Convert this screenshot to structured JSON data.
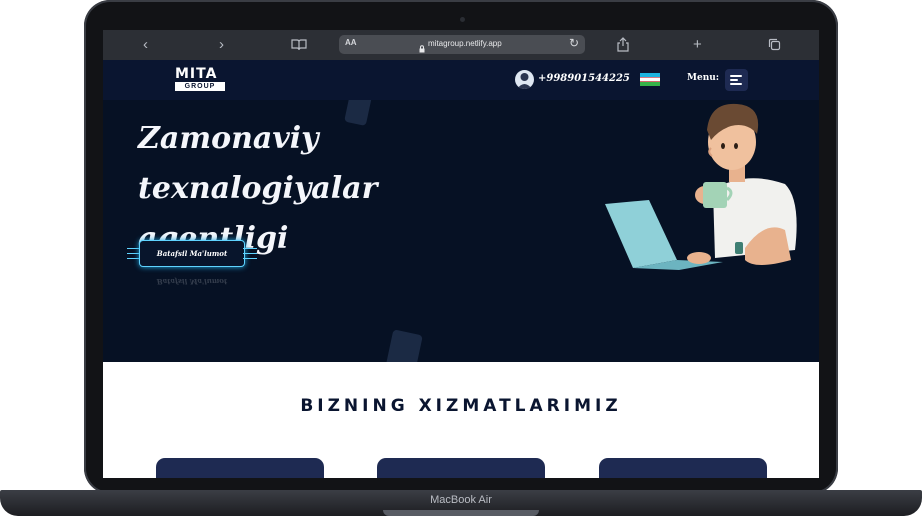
{
  "device": {
    "label": "MacBook Air"
  },
  "browser": {
    "aa_label": "AA",
    "url": "mitagroup.netlify.app",
    "icons": [
      "chevron-left-icon",
      "chevron-right-icon",
      "book-icon",
      "lock-icon",
      "reload-icon",
      "share-icon",
      "plus-icon",
      "tabs-icon"
    ]
  },
  "header": {
    "logo_top": "MITA",
    "logo_bottom": "GROUP",
    "phone": "+998901544225",
    "menu_label": "Menu:",
    "flag": "uzbekistan-flag"
  },
  "hero": {
    "title": "Zamonaviy texnalogiyalar agentligi",
    "cta_label": "Batafsil Ma'lumot"
  },
  "services": {
    "title": "Bizning xizmatlarimiz",
    "card_count": 3
  },
  "colors": {
    "hero_bg": "#061124",
    "header_bg": "#0a1530",
    "accent": "#5fd3ff",
    "card_bg": "#1e2a52"
  }
}
